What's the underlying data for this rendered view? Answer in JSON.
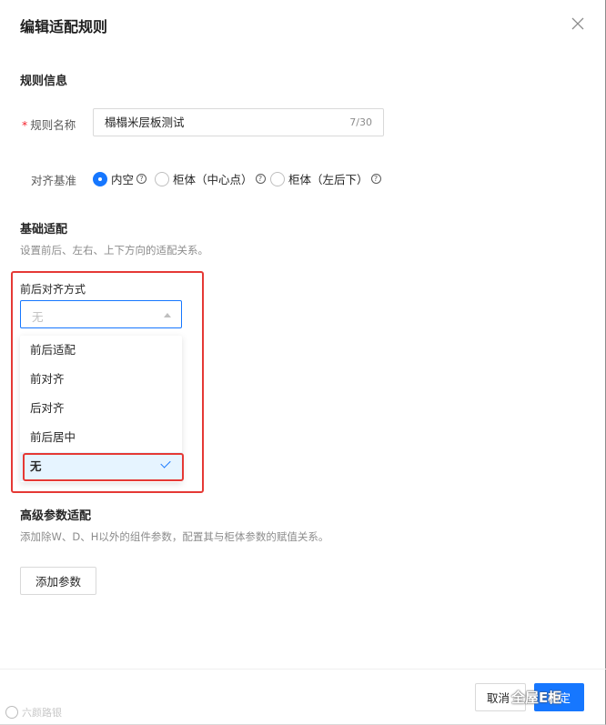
{
  "dialog": {
    "title": "编辑适配规则",
    "close_icon": "close-icon"
  },
  "rule_info": {
    "section_title": "规则信息",
    "name_label": "规则名称",
    "name_value": "榻榻米层板测试",
    "name_count": "7/30",
    "align_label": "对齐基准",
    "radios": [
      {
        "label": "内空",
        "selected": true
      },
      {
        "label": "柜体（中心点）",
        "selected": false
      },
      {
        "label": "柜体（左后下）",
        "selected": false
      }
    ],
    "help_glyph": "?"
  },
  "basic_fit": {
    "section_title": "基础适配",
    "description": "设置前后、左右、上下方向的适配关系。",
    "field_label": "前后对齐方式",
    "select_value": "无",
    "options": [
      "前后适配",
      "前对齐",
      "后对齐",
      "前后居中",
      "无"
    ],
    "selected_option": "无"
  },
  "advanced": {
    "section_title": "高级参数适配",
    "description": "添加除W、D、H以外的组件参数，配置其与柜体参数的赋值关系。",
    "add_button": "添加参数"
  },
  "footer": {
    "cancel": "取消",
    "ok": "确定"
  },
  "watermarks": {
    "left": "六颜路银",
    "right": "全屋E柜"
  },
  "colors": {
    "primary": "#1677ff",
    "highlight": "#e53935",
    "selected_bg": "#e6f4ff"
  }
}
